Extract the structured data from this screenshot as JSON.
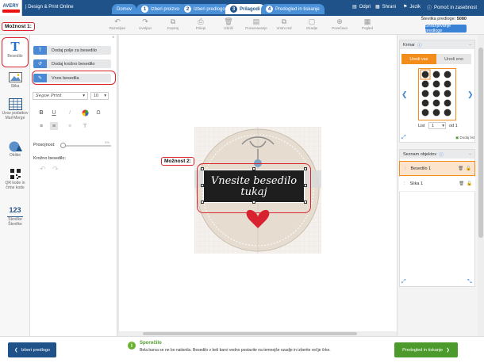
{
  "app": {
    "logo_text": "AVERY",
    "title": "| Design & Print Online"
  },
  "steps": [
    {
      "num": "",
      "label": "Domov"
    },
    {
      "num": "1",
      "label": "Izberi proizvod"
    },
    {
      "num": "2",
      "label": "Izberi predlogo"
    },
    {
      "num": "3",
      "label": "Prilagodi"
    },
    {
      "num": "4",
      "label": "Predogled in tiskanje"
    }
  ],
  "topnav": {
    "open": "Odpri",
    "save": "Shrani",
    "language": "Jezik",
    "help": "Pomoč in zasebnost"
  },
  "toolbar": {
    "tools": [
      "Razveljavi",
      "Uveljavi",
      "Kopiraj",
      "Prilepi",
      "Izbriši",
      "Poravnavanje",
      "Vrstni red",
      "Ozadje",
      "Povečava",
      "Pogled"
    ],
    "template_number_label": "Številka predloge:",
    "template_number": "5080",
    "save_template": "Shranjevanje predloge"
  },
  "annotations": {
    "option1": "Možnost 1:",
    "option2": "Možnost 2:"
  },
  "leftbar": [
    {
      "label": "Besedilo",
      "icon": "text-icon"
    },
    {
      "label": "Slika",
      "icon": "image-icon"
    },
    {
      "label": "Uvoz podatkov Mail Merge",
      "icon": "table-icon"
    },
    {
      "label": "Oblike",
      "icon": "shapes-icon"
    },
    {
      "label": "QR kode in črtne kode",
      "icon": "qr-icon"
    },
    {
      "label": "Številke Številke",
      "icon": "numbers-icon"
    }
  ],
  "panel": {
    "add_text_field": "Dodaj polje za besedilo",
    "add_circle_text": "Dodaj krožno besedilo",
    "text_input": "Vnos besedila",
    "font": "Segoe Print",
    "font_size": "10",
    "transparency_label": "Prosojnost:",
    "transparency_value": "0%",
    "circle_text_label": "Krožno besedilo:"
  },
  "canvas": {
    "label_text_line1": "Vnesite besedilo",
    "label_text_line2": "tukaj"
  },
  "rightpanel": {
    "sheet_title": "Krmar",
    "tab_use_all": "Uredi vse",
    "tab_use_one": "Uredi eno",
    "sheet_label": "List",
    "sheet_value": "1",
    "sheet_of": "od 1",
    "add_sheet": "Dodaj list",
    "objects_title": "Seznam objektov",
    "layers": [
      {
        "name": "Besedilo 1"
      },
      {
        "name": "Slika 1"
      }
    ]
  },
  "bottom": {
    "back": "Izberi predlogo",
    "message_title": "Sporočilo",
    "message_text": "Bela barva se ne bo natisnila. Besedilo v beli barvi vedno postavite na temnejše ozadje in izberite večje črke.",
    "forward": "Predogled in tiskanje"
  },
  "colors": {
    "brand": "#1f5289",
    "accent_orange": "#f28c1b",
    "annotation_red": "#d9232d",
    "green": "#4d9a2c"
  }
}
